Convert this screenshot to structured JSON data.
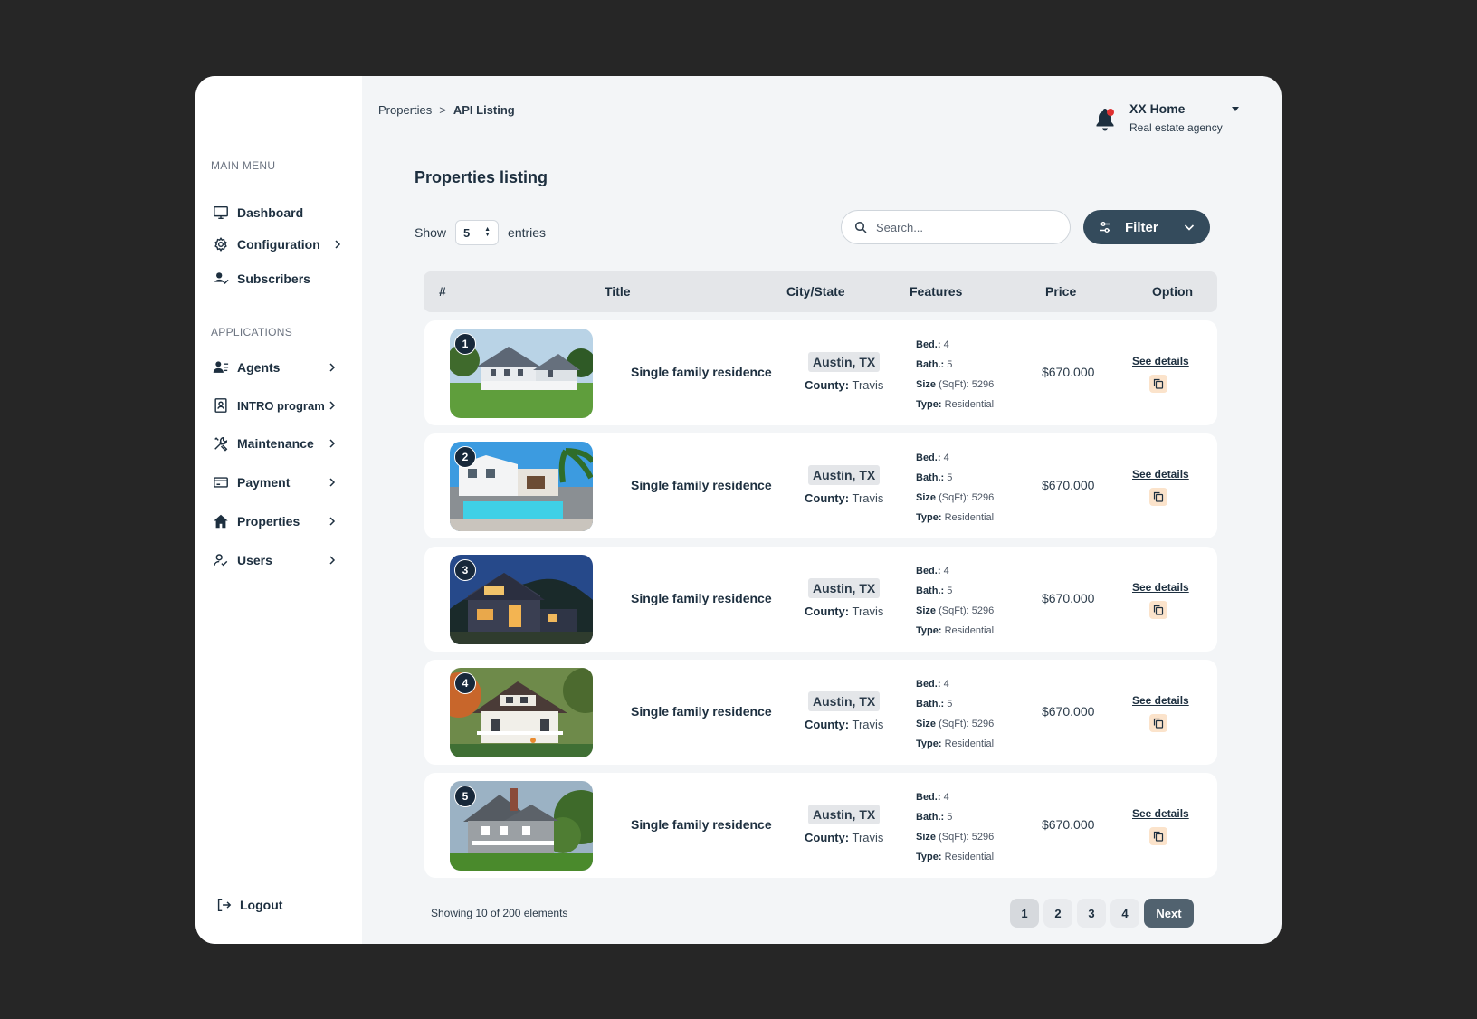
{
  "sidebar": {
    "main_menu_heading": "MAIN MENU",
    "applications_heading": "APPLICATIONS",
    "main_items": [
      {
        "label": "Dashboard",
        "icon": "monitor-icon"
      },
      {
        "label": "Configuration",
        "icon": "gear-icon"
      },
      {
        "label": "Subscribers",
        "icon": "user-check-icon"
      }
    ],
    "app_items": [
      {
        "label": "Agents",
        "icon": "users-list-icon"
      },
      {
        "label": "INTRO program",
        "icon": "id-card-icon"
      },
      {
        "label": "Maintenance",
        "icon": "tools-icon"
      },
      {
        "label": "Payment",
        "icon": "credit-card-icon"
      },
      {
        "label": "Properties",
        "icon": "home-icon"
      },
      {
        "label": "Users",
        "icon": "user-icon"
      }
    ],
    "logout_label": "Logout"
  },
  "breadcrumb": {
    "parent": "Properties",
    "separator": ">",
    "current": "API Listing"
  },
  "account": {
    "name": "XX Home",
    "subtitle": "Real estate agency"
  },
  "page_title": "Properties listing",
  "controls": {
    "show_label": "Show",
    "entries_value": "5",
    "entries_label": "entries",
    "search_placeholder": "Search...",
    "filter_label": "Filter"
  },
  "table": {
    "headers": [
      "#",
      "Title",
      "City/State",
      "Features",
      "Price",
      "Option"
    ],
    "rows": [
      {
        "num": "1",
        "title": "Single family residence",
        "city": "Austin, TX",
        "county_label": "County:",
        "county": "Travis",
        "bed_label": "Bed.:",
        "bed": "4",
        "bath_label": "Bath.:",
        "bath": "5",
        "size_label": "Size",
        "size_unit": "(SqFt):",
        "size": "5296",
        "type_label": "Type:",
        "type": "Residential",
        "price": "$670.000",
        "details_label": "See details"
      },
      {
        "num": "2",
        "title": "Single family residence",
        "city": "Austin, TX",
        "county_label": "County:",
        "county": "Travis",
        "bed_label": "Bed.:",
        "bed": "4",
        "bath_label": "Bath.:",
        "bath": "5",
        "size_label": "Size",
        "size_unit": "(SqFt):",
        "size": "5296",
        "type_label": "Type:",
        "type": "Residential",
        "price": "$670.000",
        "details_label": "See details"
      },
      {
        "num": "3",
        "title": "Single family residence",
        "city": "Austin, TX",
        "county_label": "County:",
        "county": "Travis",
        "bed_label": "Bed.:",
        "bed": "4",
        "bath_label": "Bath.:",
        "bath": "5",
        "size_label": "Size",
        "size_unit": "(SqFt):",
        "size": "5296",
        "type_label": "Type:",
        "type": "Residential",
        "price": "$670.000",
        "details_label": "See details"
      },
      {
        "num": "4",
        "title": "Single family residence",
        "city": "Austin, TX",
        "county_label": "County:",
        "county": "Travis",
        "bed_label": "Bed.:",
        "bed": "4",
        "bath_label": "Bath.:",
        "bath": "5",
        "size_label": "Size",
        "size_unit": "(SqFt):",
        "size": "5296",
        "type_label": "Type:",
        "type": "Residential",
        "price": "$670.000",
        "details_label": "See details"
      },
      {
        "num": "5",
        "title": "Single family residence",
        "city": "Austin, TX",
        "county_label": "County:",
        "county": "Travis",
        "bed_label": "Bed.:",
        "bed": "4",
        "bath_label": "Bath.:",
        "bath": "5",
        "size_label": "Size",
        "size_unit": "(SqFt):",
        "size": "5296",
        "type_label": "Type:",
        "type": "Residential",
        "price": "$670.000",
        "details_label": "See details"
      }
    ]
  },
  "footer": {
    "showing_text": "Showing 10 of 200 elements",
    "pages": [
      "1",
      "2",
      "3",
      "4"
    ],
    "active_page": "1",
    "next_label": "Next"
  },
  "colors": {
    "page_background": "#262626",
    "accent_dark": "#344b5c",
    "next_button": "#51626f",
    "copy_button": "#fbe3cb",
    "notification_dot": "#e03131"
  }
}
